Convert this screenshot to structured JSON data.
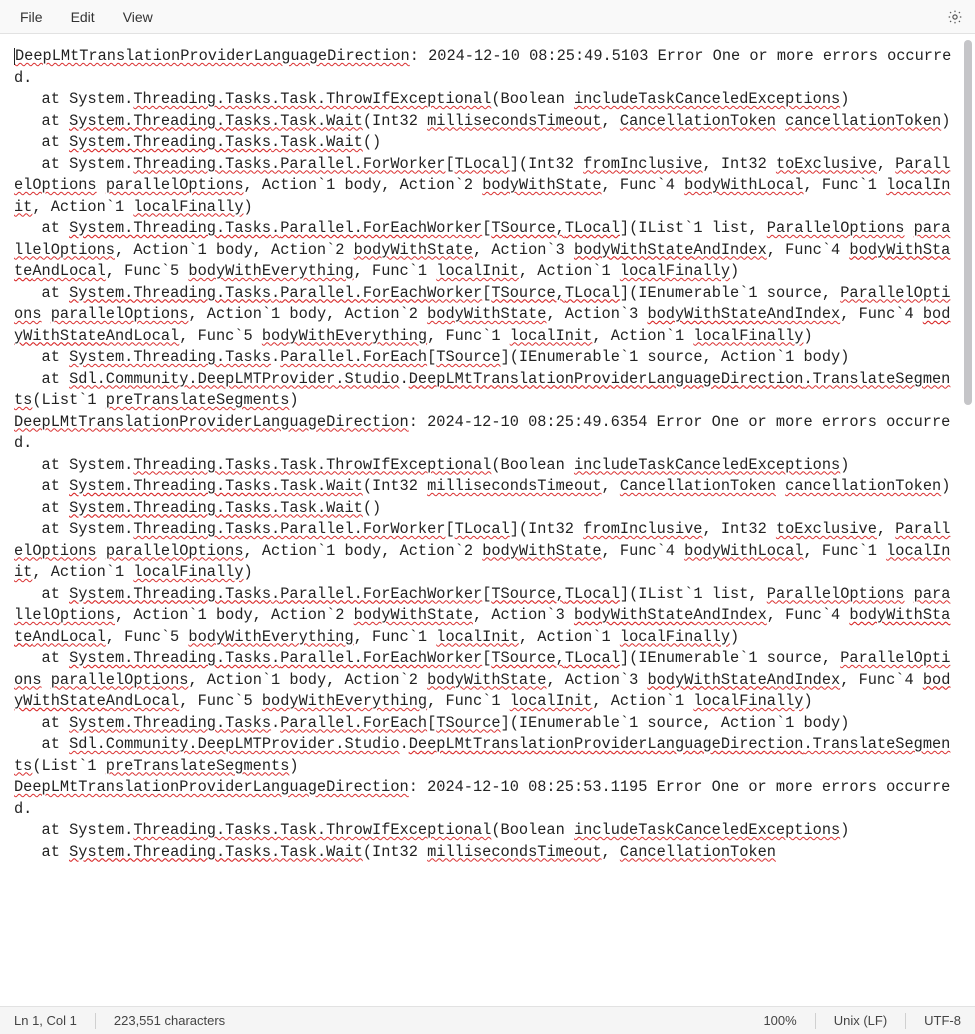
{
  "menu": {
    "file": "File",
    "edit": "Edit",
    "view": "View",
    "settings_icon": "gear-icon"
  },
  "status": {
    "cursor": "Ln 1, Col 1",
    "chars": "223,551 characters",
    "zoom": "100%",
    "line_ending": "Unix (LF)",
    "encoding": "UTF-8"
  },
  "log": {
    "entries": [
      {
        "source": "DeepLMtTranslationProviderLanguageDirection",
        "timestamp": "2024-12-10 08:25:49.5103",
        "level": "Error",
        "message": "One or more errors occurred.",
        "stack": [
          "   at System.Threading.Tasks.Task.ThrowIfExceptional(Boolean includeTaskCanceledExceptions)",
          "   at System.Threading.Tasks.Task.Wait(Int32 millisecondsTimeout, CancellationToken cancellationToken)",
          "   at System.Threading.Tasks.Task.Wait()",
          "   at System.Threading.Tasks.Parallel.ForWorker[TLocal](Int32 fromInclusive, Int32 toExclusive, ParallelOptions parallelOptions, Action`1 body, Action`2 bodyWithState, Func`4 bodyWithLocal, Func`1 localInit, Action`1 localFinally)",
          "   at System.Threading.Tasks.Parallel.ForEachWorker[TSource,TLocal](IList`1 list, ParallelOptions parallelOptions, Action`1 body, Action`2 bodyWithState, Action`3 bodyWithStateAndIndex, Func`4 bodyWithStateAndLocal, Func`5 bodyWithEverything, Func`1 localInit, Action`1 localFinally)",
          "   at System.Threading.Tasks.Parallel.ForEachWorker[TSource,TLocal](IEnumerable`1 source, ParallelOptions parallelOptions, Action`1 body, Action`2 bodyWithState, Action`3 bodyWithStateAndIndex, Func`4 bodyWithStateAndLocal, Func`5 bodyWithEverything, Func`1 localInit, Action`1 localFinally)",
          "   at System.Threading.Tasks.Parallel.ForEach[TSource](IEnumerable`1 source, Action`1 body)",
          "   at Sdl.Community.DeepLMTProvider.Studio.DeepLMtTranslationProviderLanguageDirection.TranslateSegments(List`1 preTranslateSegments)"
        ]
      },
      {
        "source": "DeepLMtTranslationProviderLanguageDirection",
        "timestamp": "2024-12-10 08:25:49.6354",
        "level": "Error",
        "message": "One or more errors occurred.",
        "stack": [
          "   at System.Threading.Tasks.Task.ThrowIfExceptional(Boolean includeTaskCanceledExceptions)",
          "   at System.Threading.Tasks.Task.Wait(Int32 millisecondsTimeout, CancellationToken cancellationToken)",
          "   at System.Threading.Tasks.Task.Wait()",
          "   at System.Threading.Tasks.Parallel.ForWorker[TLocal](Int32 fromInclusive, Int32 toExclusive, ParallelOptions parallelOptions, Action`1 body, Action`2 bodyWithState, Func`4 bodyWithLocal, Func`1 localInit, Action`1 localFinally)",
          "   at System.Threading.Tasks.Parallel.ForEachWorker[TSource,TLocal](IList`1 list, ParallelOptions parallelOptions, Action`1 body, Action`2 bodyWithState, Action`3 bodyWithStateAndIndex, Func`4 bodyWithStateAndLocal, Func`5 bodyWithEverything, Func`1 localInit, Action`1 localFinally)",
          "   at System.Threading.Tasks.Parallel.ForEachWorker[TSource,TLocal](IEnumerable`1 source, ParallelOptions parallelOptions, Action`1 body, Action`2 bodyWithState, Action`3 bodyWithStateAndIndex, Func`4 bodyWithStateAndLocal, Func`5 bodyWithEverything, Func`1 localInit, Action`1 localFinally)",
          "   at System.Threading.Tasks.Parallel.ForEach[TSource](IEnumerable`1 source, Action`1 body)",
          "   at Sdl.Community.DeepLMTProvider.Studio.DeepLMtTranslationProviderLanguageDirection.TranslateSegments(List`1 preTranslateSegments)"
        ]
      },
      {
        "source": "DeepLMtTranslationProviderLanguageDirection",
        "timestamp": "2024-12-10 08:25:53.1195",
        "level": "Error",
        "message": "One or more errors occurred.",
        "stack": [
          "   at System.Threading.Tasks.Task.ThrowIfExceptional(Boolean includeTaskCanceledExceptions)",
          "   at System.Threading.Tasks.Task.Wait(Int32 millisecondsTimeout, CancellationToken"
        ]
      }
    ],
    "truncated_last_line": true,
    "spellcheck_tokens": [
      "DeepLMtTranslationProviderLanguageDirection",
      "Threading.Tasks.Task.ThrowIfExceptional",
      "includeTaskCanceledExceptions",
      "System.Threading.Tasks.Task.Wait",
      "millisecondsTimeout",
      "CancellationToken",
      "cancellationToken",
      "System.Threading.Tasks.Task.Wait",
      "Threading.Tasks.Parallel.ForWorker",
      "TLocal",
      "fromInclusive",
      "toExclusive",
      "ParallelOptions",
      "parallelOptions",
      "bodyWithState",
      "bodyWithLocal",
      "localInit",
      "localFinally",
      "System.Threading.Tasks.Parallel.ForEachWorker",
      "TSource,TLocal",
      "ParallelOptions",
      "parallelOptions",
      "bodyWithState",
      "bodyWithStateAndIndex",
      "bodyWithStateAndLocal",
      "bodyWithEverything",
      "localInit",
      "localFinally",
      "System.Threading.Tasks.Parallel.ForEachWorker",
      "TSource,TLocal",
      "ParallelOptions",
      "parallelOptions",
      "bodyWithState",
      "bodyWithStateAndIndex",
      "bodyWithStateAndLocal",
      "bodyWithEverything",
      "localInit",
      "localFinally",
      "System.Threading.Tasks",
      "Parallel.ForEach",
      "TSource",
      "Sdl.Community.DeepLMTProvider.Studio",
      "DeepLMtTranslationProviderLanguageDirection.TranslateSegments",
      "preTranslateSegments",
      "System.Threading.Tasks.Task.Wait"
    ]
  }
}
